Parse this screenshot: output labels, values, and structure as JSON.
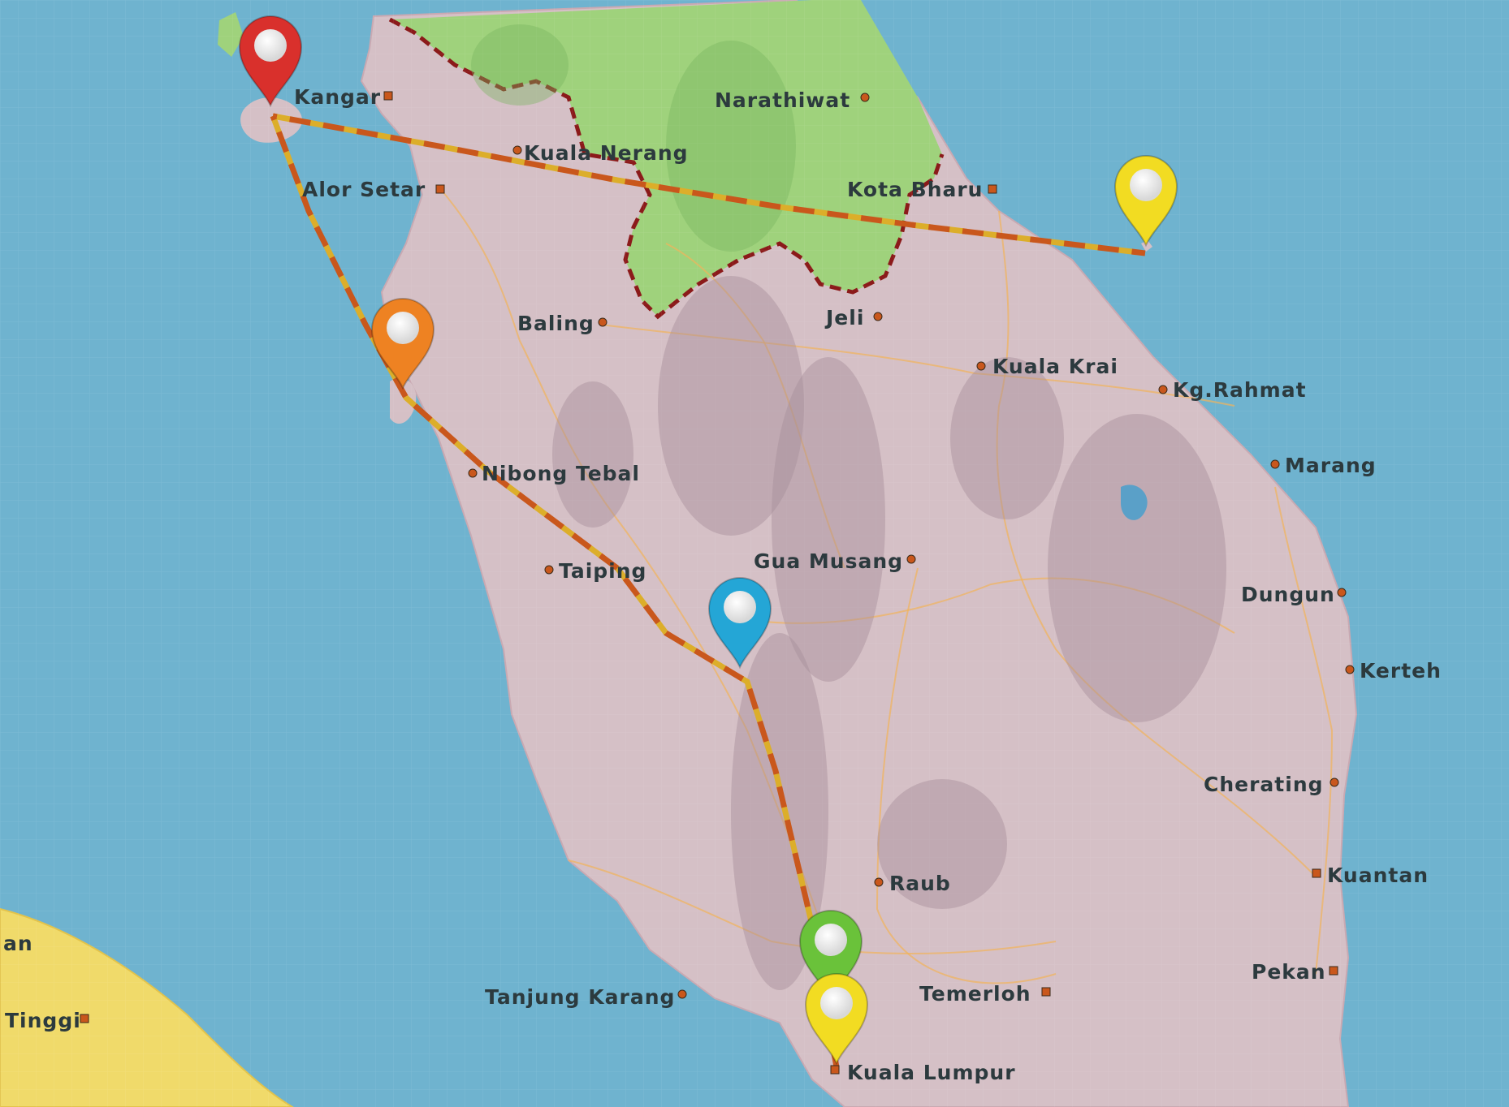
{
  "map": {
    "colors": {
      "sea": "#6fb3cf",
      "malaysia": "#d5c0c6",
      "thailand": "#9fd27c",
      "sumatra": "#f0da6a",
      "route_dark": "#c9571c",
      "route_light": "#dcae2a",
      "border": "#8b1a1a"
    },
    "places": [
      {
        "name": "Kangar",
        "dot": "square"
      },
      {
        "name": "Narathiwat",
        "dot": "circle"
      },
      {
        "name": "Kuala Nerang",
        "dot": "circle"
      },
      {
        "name": "Alor Setar",
        "dot": "square"
      },
      {
        "name": "Kota Bharu",
        "dot": "square"
      },
      {
        "name": "Baling",
        "dot": "circle"
      },
      {
        "name": "Jeli",
        "dot": "circle"
      },
      {
        "name": "Kuala Krai",
        "dot": "circle"
      },
      {
        "name": "Kg.Rahmat",
        "dot": "circle"
      },
      {
        "name": "Marang",
        "dot": "circle"
      },
      {
        "name": "Nibong Tebal",
        "dot": "circle"
      },
      {
        "name": "Taiping",
        "dot": "circle"
      },
      {
        "name": "Gua Musang",
        "dot": "circle"
      },
      {
        "name": "Dungun",
        "dot": "circle"
      },
      {
        "name": "Kerteh",
        "dot": "circle"
      },
      {
        "name": "Cherating",
        "dot": "circle"
      },
      {
        "name": "Raub",
        "dot": "circle"
      },
      {
        "name": "Kuantan",
        "dot": "square"
      },
      {
        "name": "Pekan",
        "dot": "square"
      },
      {
        "name": "Temerloh",
        "dot": "square"
      },
      {
        "name": "Tanjung Karang",
        "dot": "circle"
      },
      {
        "name": "Kuala Lumpur",
        "dot": "square"
      },
      {
        "name": "Tinggi",
        "dot": "square"
      },
      {
        "name": "an",
        "dot": "none"
      }
    ],
    "markers": [
      {
        "id": "marker-red",
        "color": "#d9302c"
      },
      {
        "id": "marker-orange",
        "color": "#ee8222"
      },
      {
        "id": "marker-yellow-east",
        "color": "#f2dc22"
      },
      {
        "id": "marker-blue",
        "color": "#24a6d6"
      },
      {
        "id": "marker-green",
        "color": "#6ac23a"
      },
      {
        "id": "marker-yellow-kl",
        "color": "#f2dc22"
      }
    ]
  }
}
